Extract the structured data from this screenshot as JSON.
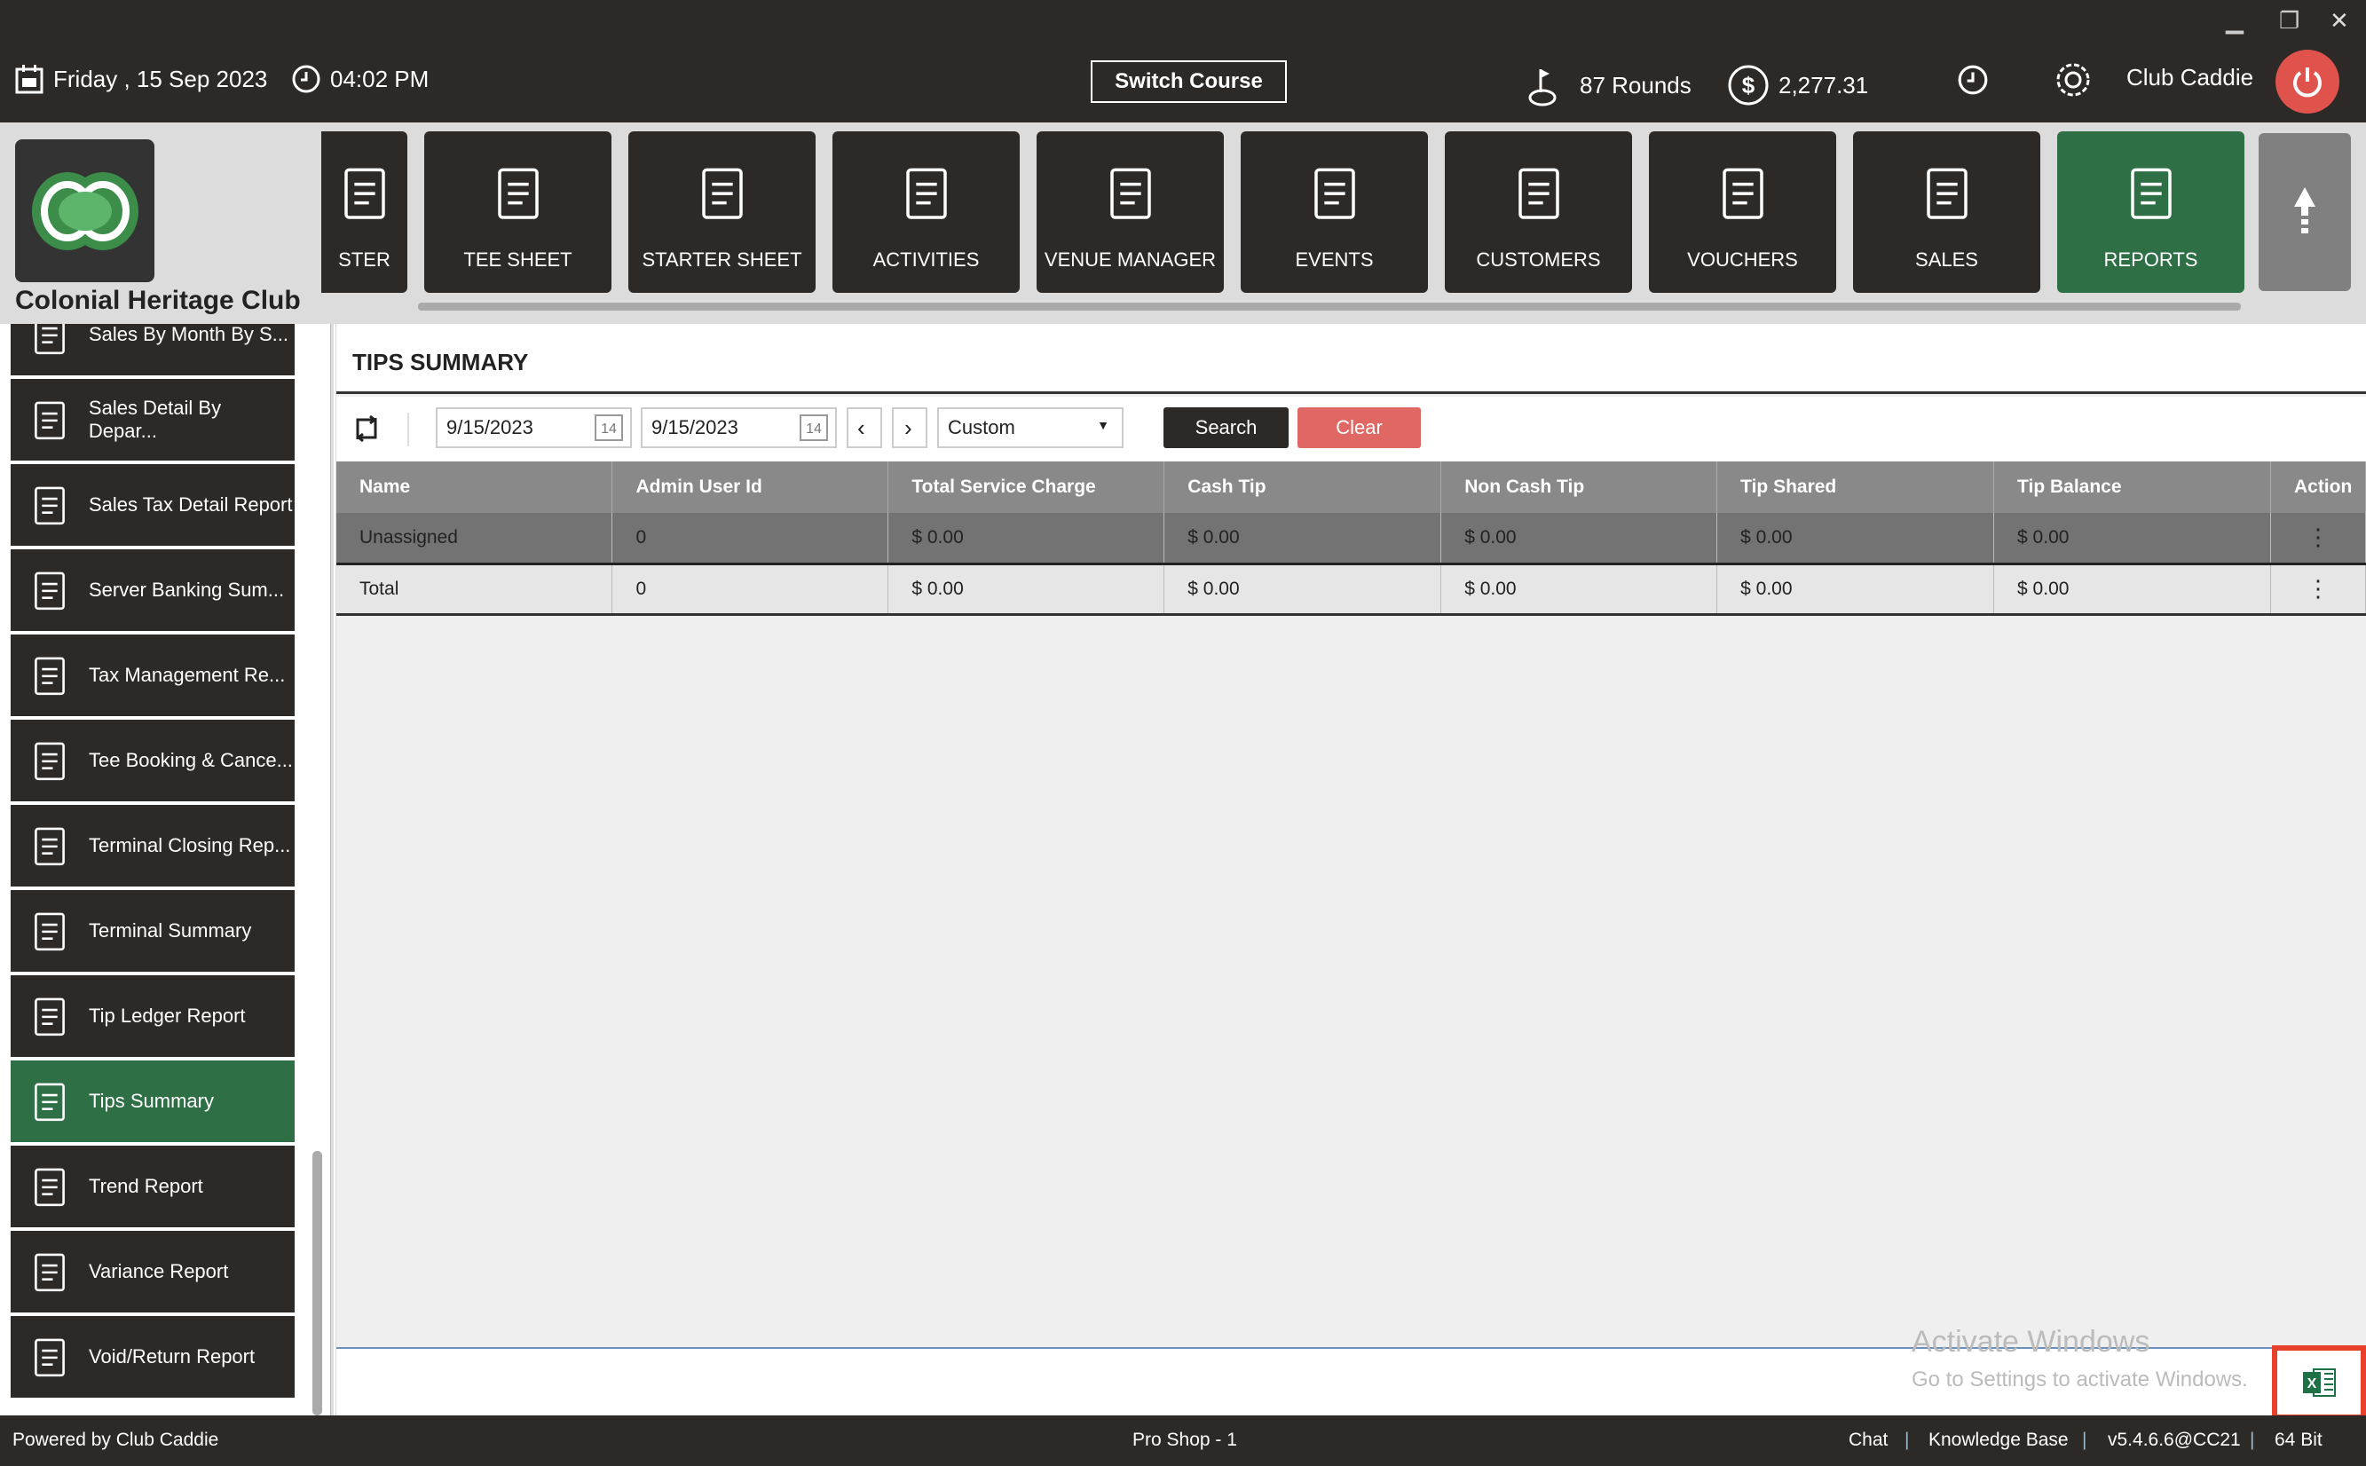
{
  "header": {
    "date": "Friday ,  15 Sep 2023",
    "time": "04:02 PM",
    "switch_course": "Switch Course",
    "rounds": "87 Rounds",
    "balance": "2,277.31",
    "user": "Club Caddie"
  },
  "club_name": "Colonial Heritage Club",
  "nav_tiles": [
    {
      "label": "STER",
      "icon": "golf-bag-icon"
    },
    {
      "label": "TEE SHEET",
      "icon": "tee-sheet-icon"
    },
    {
      "label": "STARTER SHEET",
      "icon": "tablet-icon"
    },
    {
      "label": "ACTIVITIES",
      "icon": "calendar-list-icon"
    },
    {
      "label": "VENUE MANAGER",
      "icon": "meeting-icon"
    },
    {
      "label": "EVENTS",
      "icon": "calendar-edit-icon"
    },
    {
      "label": "CUSTOMERS",
      "icon": "users-icon"
    },
    {
      "label": "VOUCHERS",
      "icon": "voucher-icon"
    },
    {
      "label": "SALES",
      "icon": "money-stack-icon"
    },
    {
      "label": "REPORTS",
      "icon": "report-icon",
      "active": true
    }
  ],
  "sidebar": [
    {
      "label": "Sales By Month By S..."
    },
    {
      "label": "Sales Detail By Depar..."
    },
    {
      "label": "Sales Tax Detail Report"
    },
    {
      "label": "Server Banking Sum..."
    },
    {
      "label": "Tax Management Re..."
    },
    {
      "label": "Tee Booking & Cance..."
    },
    {
      "label": "Terminal Closing Rep..."
    },
    {
      "label": "Terminal Summary"
    },
    {
      "label": "Tip Ledger Report"
    },
    {
      "label": "Tips Summary",
      "active": true
    },
    {
      "label": "Trend Report"
    },
    {
      "label": "Variance Report"
    },
    {
      "label": "Void/Return Report"
    }
  ],
  "page": {
    "title": "TIPS SUMMARY",
    "from_date": "9/15/2023",
    "to_date": "9/15/2023",
    "range": "Custom",
    "search": "Search",
    "clear": "Clear",
    "cal_day": "14"
  },
  "table": {
    "columns": [
      "Name",
      "Admin User Id",
      "Total Service Charge",
      "Cash Tip",
      "Non Cash Tip",
      "Tip Shared",
      "Tip Balance",
      "Action"
    ],
    "rows": [
      [
        "Unassigned",
        "0",
        "$ 0.00",
        "$ 0.00",
        "$ 0.00",
        "$ 0.00",
        "$ 0.00"
      ],
      [
        "Total",
        "0",
        "$ 0.00",
        "$ 0.00",
        "$ 0.00",
        "$ 0.00",
        "$ 0.00"
      ]
    ]
  },
  "watermark": {
    "line1": "Activate Windows",
    "line2": "Go to Settings to activate Windows."
  },
  "footer": {
    "powered": "Powered by Club Caddie",
    "station": "Pro Shop - 1",
    "chat": "Chat",
    "kb": "Knowledge Base",
    "version": "v5.4.6.6@CC21",
    "bits": "64 Bit",
    "sep": "|"
  },
  "colors": {
    "dark": "#2d2926",
    "accent": "#2e6f45",
    "danger": "#e0534c"
  }
}
